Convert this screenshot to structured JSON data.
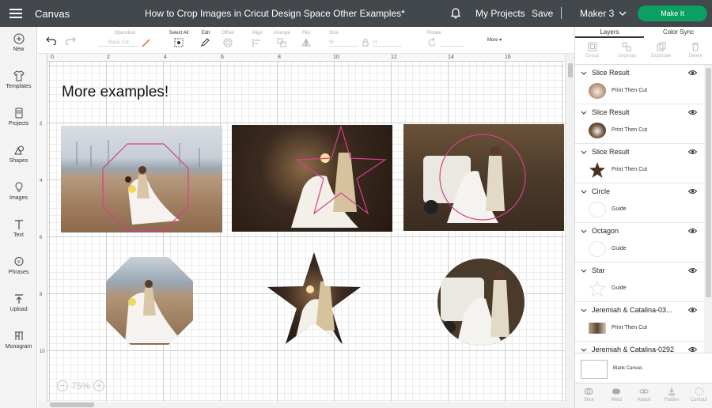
{
  "topbar": {
    "canvas_label": "Canvas",
    "document_title": "How to Crop Images in Cricut Design Space Other Examples*",
    "my_projects": "My Projects",
    "save": "Save",
    "machine": "Maker 3",
    "make_it": "Make It"
  },
  "sidebar": {
    "items": [
      {
        "label": "New",
        "icon": "plus-circle-icon"
      },
      {
        "label": "Templates",
        "icon": "shirt-icon"
      },
      {
        "label": "Projects",
        "icon": "projects-icon"
      },
      {
        "label": "Shapes",
        "icon": "shapes-icon"
      },
      {
        "label": "Images",
        "icon": "lightbulb-icon"
      },
      {
        "label": "Text",
        "icon": "text-icon"
      },
      {
        "label": "Phrases",
        "icon": "speech-bubble-icon"
      },
      {
        "label": "Upload",
        "icon": "upload-icon"
      },
      {
        "label": "Monogram",
        "icon": "monogram-icon"
      }
    ]
  },
  "toolbar": {
    "operation_label": "Operation",
    "operation_value": "Basic Cut",
    "select_all": "Select All",
    "edit": "Edit",
    "offset": "Offset",
    "align": "Align",
    "arrange": "Arrange",
    "flip": "Flip",
    "size": "Size",
    "size_w": "W",
    "size_h": "H",
    "rotate": "Rotate",
    "more": "More"
  },
  "rulers": {
    "top": [
      "0",
      "2",
      "4",
      "6",
      "8",
      "10",
      "12",
      "14",
      "16"
    ],
    "left": [
      "2",
      "4",
      "6",
      "8",
      "10"
    ]
  },
  "canvas": {
    "heading": "More examples!",
    "zoom": "75%",
    "zoom_in": "+",
    "zoom_out": "−"
  },
  "right_panel": {
    "tabs": [
      "Layers",
      "Color Sync"
    ],
    "actions": [
      "Group",
      "Ungroup",
      "Duplicate",
      "Delete"
    ],
    "layers": [
      {
        "title": "Slice Result",
        "sub": "Print Then Cut",
        "thumb": "photo-circle"
      },
      {
        "title": "Slice Result",
        "sub": "Print Then Cut",
        "thumb": "photo-circle"
      },
      {
        "title": "Slice Result",
        "sub": "Print Then Cut",
        "thumb": "photo-star"
      },
      {
        "title": "Circle",
        "sub": "Guide",
        "thumb": "circle-guide"
      },
      {
        "title": "Octagon",
        "sub": "Guide",
        "thumb": "circle-guide"
      },
      {
        "title": "Star",
        "sub": "Guide",
        "thumb": "star-guide"
      },
      {
        "title": "Jeremiah & Catalina-03...",
        "sub": "Print Then Cut",
        "thumb": "photo-rect"
      },
      {
        "title": "Jeremiah & Catalina-0292",
        "sub": "",
        "thumb": "none"
      }
    ],
    "blank_canvas": "Blank Canvas",
    "bottom_tools": [
      "Slice",
      "Weld",
      "Attach",
      "Flatten",
      "Contour"
    ]
  },
  "colors": {
    "topbar": "#43484d",
    "make_it": "#0aa061",
    "guide_line": "#d4408a"
  }
}
